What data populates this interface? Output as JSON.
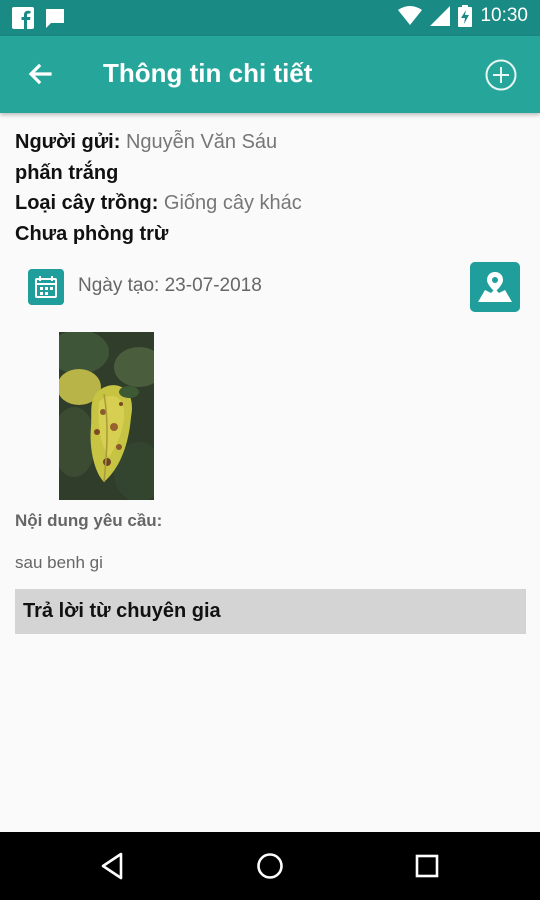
{
  "status_bar": {
    "time": "10:30",
    "icons": [
      "facebook-icon",
      "message-icon",
      "wifi-icon",
      "signal-icon",
      "battery-charging-icon"
    ]
  },
  "app_bar": {
    "title": "Thông tin chi tiết",
    "back_icon": "arrow-back-icon",
    "add_icon": "add-circle-icon"
  },
  "details": {
    "sender_label": "Người gửi:",
    "sender_value": "Nguyễn Văn Sáu",
    "disease": "phấn trắng",
    "crop_label": "Loại cây trồng:",
    "crop_value": "Giống cây khác",
    "treatment_status": "Chưa phòng trừ",
    "created_date": "Ngày tạo: 23-07-2018"
  },
  "request": {
    "label": "Nội dung yêu cầu:",
    "text": "sau benh gi"
  },
  "reply": {
    "label": "Trả lời từ chuyên gia"
  },
  "colors": {
    "status_bar": "#1a8a84",
    "app_bar": "#26a69a",
    "accent": "#1f9e9b",
    "reply_bar": "#d4d4d4"
  }
}
